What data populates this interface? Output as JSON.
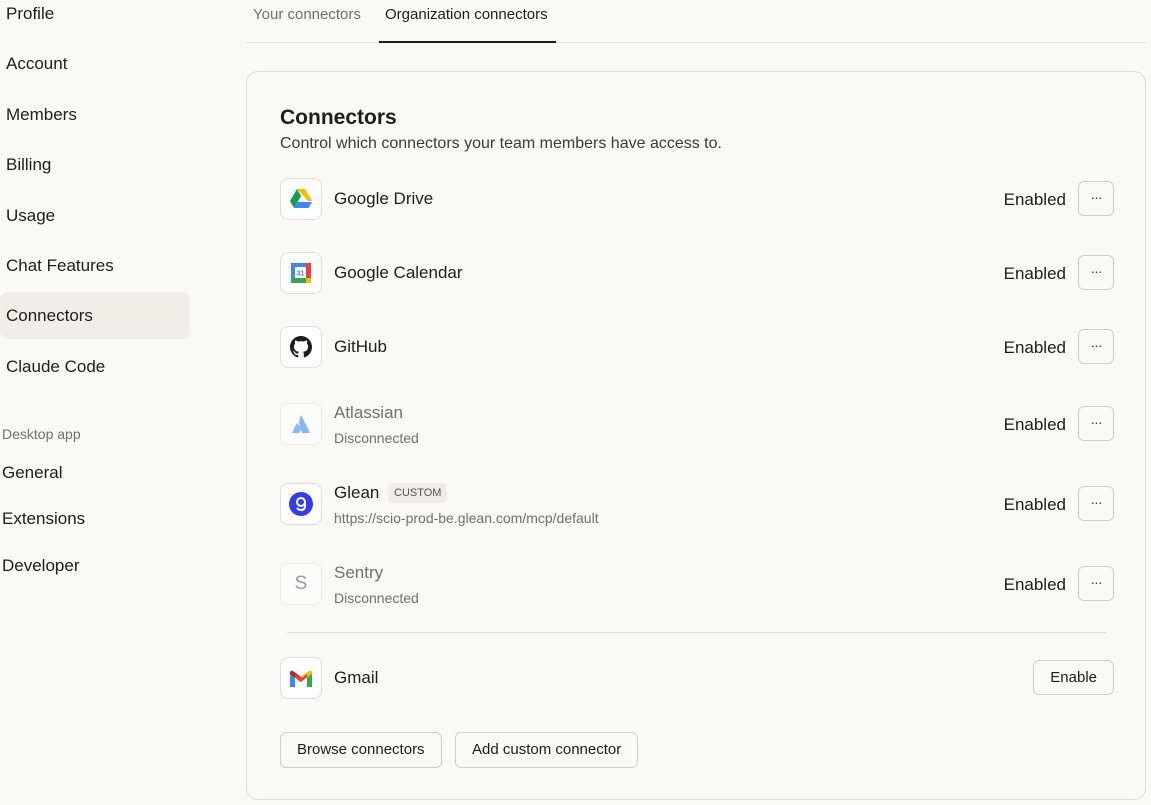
{
  "sidebar": {
    "items": [
      {
        "label": "Profile"
      },
      {
        "label": "Account"
      },
      {
        "label": "Members"
      },
      {
        "label": "Billing"
      },
      {
        "label": "Usage"
      },
      {
        "label": "Chat Features"
      },
      {
        "label": "Connectors"
      },
      {
        "label": "Claude Code"
      }
    ],
    "desktop_section_label": "Desktop app",
    "desktop_items": [
      {
        "label": "General"
      },
      {
        "label": "Extensions"
      },
      {
        "label": "Developer"
      }
    ]
  },
  "tabs": [
    {
      "label": "Your connectors"
    },
    {
      "label": "Organization connectors"
    }
  ],
  "card": {
    "title": "Connectors",
    "description": "Control which connectors your team members have access to."
  },
  "connectors": [
    {
      "name": "Google Drive",
      "status": "Enabled",
      "icon": "google-drive-icon"
    },
    {
      "name": "Google Calendar",
      "status": "Enabled",
      "icon": "google-calendar-icon",
      "calendar_day": "31"
    },
    {
      "name": "GitHub",
      "status": "Enabled",
      "icon": "github-icon"
    },
    {
      "name": "Atlassian",
      "subtitle": "Disconnected",
      "status": "Enabled",
      "icon": "atlassian-icon"
    },
    {
      "name": "Glean",
      "badge": "CUSTOM",
      "subtitle": "https://scio-prod-be.glean.com/mcp/default",
      "status": "Enabled",
      "icon": "glean-icon"
    },
    {
      "name": "Sentry",
      "subtitle": "Disconnected",
      "status": "Enabled",
      "icon": "sentry-icon",
      "icon_letter": "S"
    }
  ],
  "more_label": "···",
  "available": [
    {
      "name": "Gmail",
      "action": "Enable",
      "icon": "gmail-icon"
    }
  ],
  "buttons": {
    "browse": "Browse connectors",
    "add_custom": "Add custom connector"
  },
  "colors": {
    "background": "#faf9f5",
    "active_nav": "#f0eee6",
    "border": "#e1dfd8",
    "glean": "#343ced"
  }
}
